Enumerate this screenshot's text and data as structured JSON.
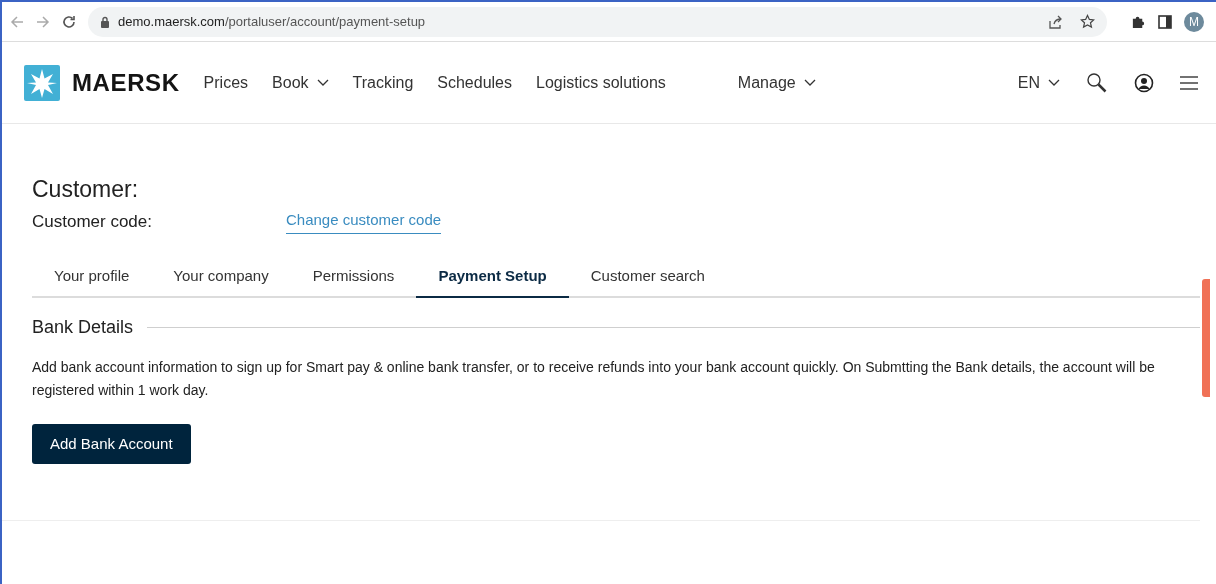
{
  "browser": {
    "url_host": "demo.maersk.com",
    "url_path": "/portaluser/account/payment-setup",
    "profile_initial": "M"
  },
  "nav": {
    "brand": "MAERSK",
    "items": [
      {
        "label": "Prices",
        "dropdown": false
      },
      {
        "label": "Book",
        "dropdown": true
      },
      {
        "label": "Tracking",
        "dropdown": false
      },
      {
        "label": "Schedules",
        "dropdown": false
      },
      {
        "label": "Logistics solutions",
        "dropdown": false
      },
      {
        "label": "Manage",
        "dropdown": true
      }
    ],
    "language": "EN"
  },
  "customer": {
    "title": "Customer:",
    "code_label": "Customer code:",
    "change_link": "Change customer code"
  },
  "tabs": [
    {
      "label": "Your profile",
      "selected": false
    },
    {
      "label": "Your company",
      "selected": false
    },
    {
      "label": "Permissions",
      "selected": false
    },
    {
      "label": "Payment Setup",
      "selected": true
    },
    {
      "label": "Customer search",
      "selected": false
    }
  ],
  "bank_details": {
    "heading": "Bank Details",
    "description": "Add bank account information to sign up for Smart pay & online bank transfer, or to receive refunds into your bank account quickly. On Submtting the Bank details, the account will be registered within 1 work day.",
    "button": "Add Bank Account"
  }
}
